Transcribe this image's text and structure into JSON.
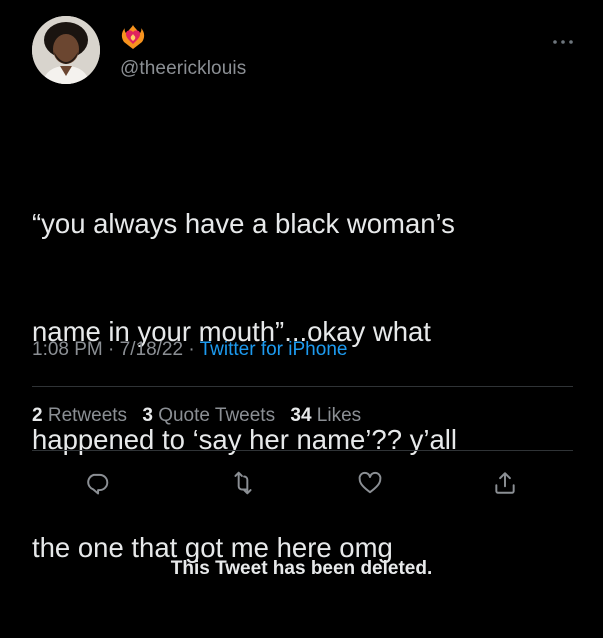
{
  "author": {
    "handle": "@theericklouis",
    "name_emoji": "heart-on-fire-emoji",
    "avatar": "profile-photo"
  },
  "tweet": {
    "text_lines": [
      "“you always have a black woman’s",
      "name in your mouth”...okay what",
      "happened to ‘say her name’?? y’all",
      "the one that got me here omg"
    ],
    "time": "1:08 PM",
    "date": "7/18/22",
    "source": "Twitter for iPhone",
    "separator": "·"
  },
  "stats": {
    "retweets_count": "2",
    "retweets_label": "Retweets",
    "quote_count": "3",
    "quote_label": "Quote Tweets",
    "likes_count": "34",
    "likes_label": "Likes"
  },
  "actions": [
    {
      "name": "reply",
      "icon": "reply-icon"
    },
    {
      "name": "retweet",
      "icon": "retweet-icon"
    },
    {
      "name": "like",
      "icon": "heart-icon"
    },
    {
      "name": "share",
      "icon": "share-icon"
    }
  ],
  "status": {
    "deleted_message": "This Tweet has been deleted."
  },
  "colors": {
    "background": "#000000",
    "text_primary": "#e7e9ea",
    "text_secondary": "#8b8f94",
    "link": "#1d9bf0",
    "divider": "#2f3336"
  }
}
